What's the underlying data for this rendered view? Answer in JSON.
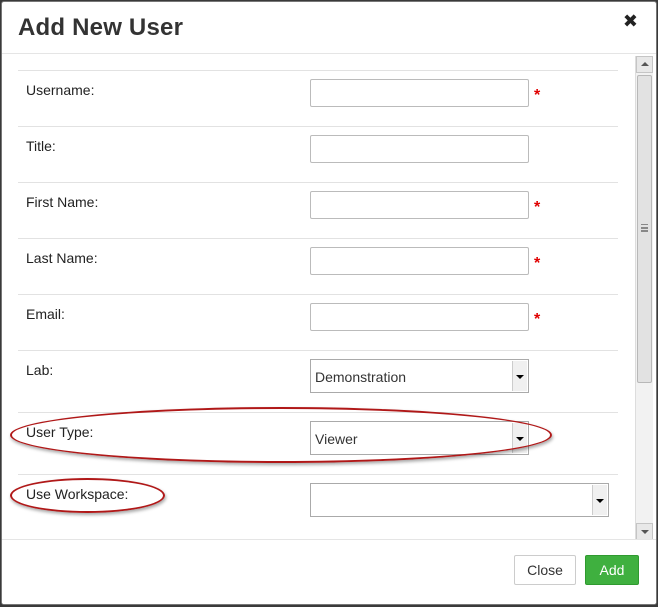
{
  "dialog": {
    "title": "Add New User",
    "close_icon": "close-icon",
    "close_glyph": "✖"
  },
  "form": {
    "required_mark": "*",
    "fields": {
      "username": {
        "label": "Username:",
        "value": "",
        "required": true
      },
      "title": {
        "label": "Title:",
        "value": "",
        "required": false
      },
      "first_name": {
        "label": "First Name:",
        "value": "",
        "required": true
      },
      "last_name": {
        "label": "Last Name:",
        "value": "",
        "required": true
      },
      "email": {
        "label": "Email:",
        "value": "",
        "required": true
      },
      "lab": {
        "label": "Lab:",
        "selected": "Demonstration"
      },
      "user_type": {
        "label": "User Type:",
        "selected": "Viewer"
      },
      "use_workspace": {
        "label": "Use Workspace:",
        "selected": ""
      }
    }
  },
  "footer": {
    "close_label": "Close",
    "add_label": "Add"
  },
  "colors": {
    "required": "#e00000",
    "highlight_ellipse": "#b01818",
    "add_button": "#3fb03f"
  }
}
